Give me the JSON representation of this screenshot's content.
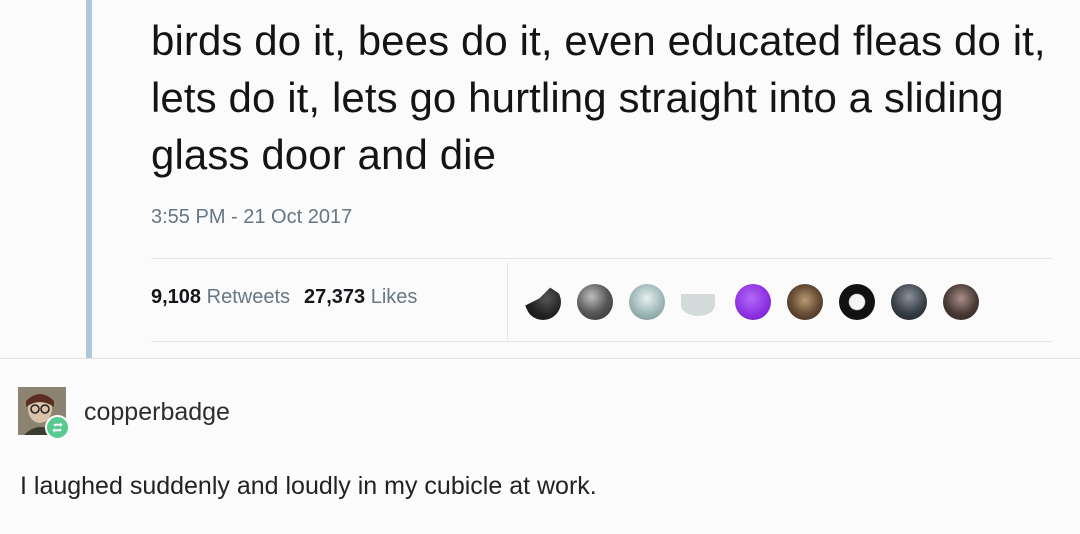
{
  "tweet": {
    "text": "birds do it, bees do it, even educated fleas do it, lets do it, lets go hurtling straight into a sliding glass door and die",
    "timestamp": "3:55 PM - 21 Oct 2017",
    "retweets_count": "9,108",
    "retweets_label": "Retweets",
    "likes_count": "27,373",
    "likes_label": "Likes",
    "liker_avatar_colors": [
      "#2b2b2b",
      "#5a5a5a",
      "#9fb8b8",
      "#c9cfcf",
      "#8b2fe0",
      "#6b5038",
      "#111111",
      "#3a4048",
      "#4a3a36"
    ]
  },
  "reblog": {
    "username": "copperbadge",
    "comment": "I laughed suddenly and loudly in my cubicle at work.",
    "badge_color": "#5ac98f",
    "badge_icon": "reblog-icon"
  },
  "colors": {
    "quote_bar": "#aec8dc",
    "secondary_text": "#657786"
  }
}
